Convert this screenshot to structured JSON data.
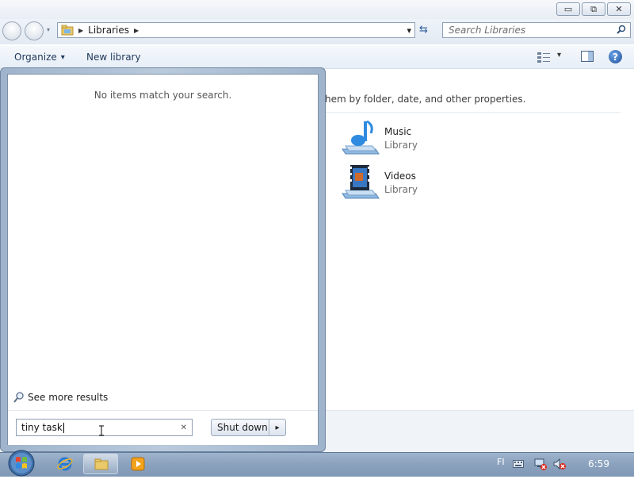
{
  "window": {
    "caption_minimize": "▭",
    "caption_maximize": "⧉",
    "caption_close": "✕"
  },
  "address": {
    "breadcrumb_arrow": "▶",
    "path": "Libraries",
    "path_arrow": "▶",
    "dropdown": "▾",
    "refresh": "⇆"
  },
  "search": {
    "placeholder": "Search Libraries"
  },
  "toolbar": {
    "organize_label": "Organize",
    "organize_caret": "▾",
    "new_library_label": "New library",
    "views_caret": "▾",
    "help_label": "?"
  },
  "content": {
    "description": "hem by folder, date, and other properties.",
    "libraries": [
      {
        "title": "Music",
        "subtitle": "Library"
      },
      {
        "title": "Videos",
        "subtitle": "Library"
      }
    ]
  },
  "start_menu": {
    "no_results_text": "No items match your search.",
    "see_more_label": "See more results",
    "search_value": "tiny task",
    "clear_icon": "✕",
    "shutdown_label": "Shut down",
    "shutdown_arrow": "▸"
  },
  "taskbar": {
    "language": "FI",
    "time": "6:59"
  }
}
